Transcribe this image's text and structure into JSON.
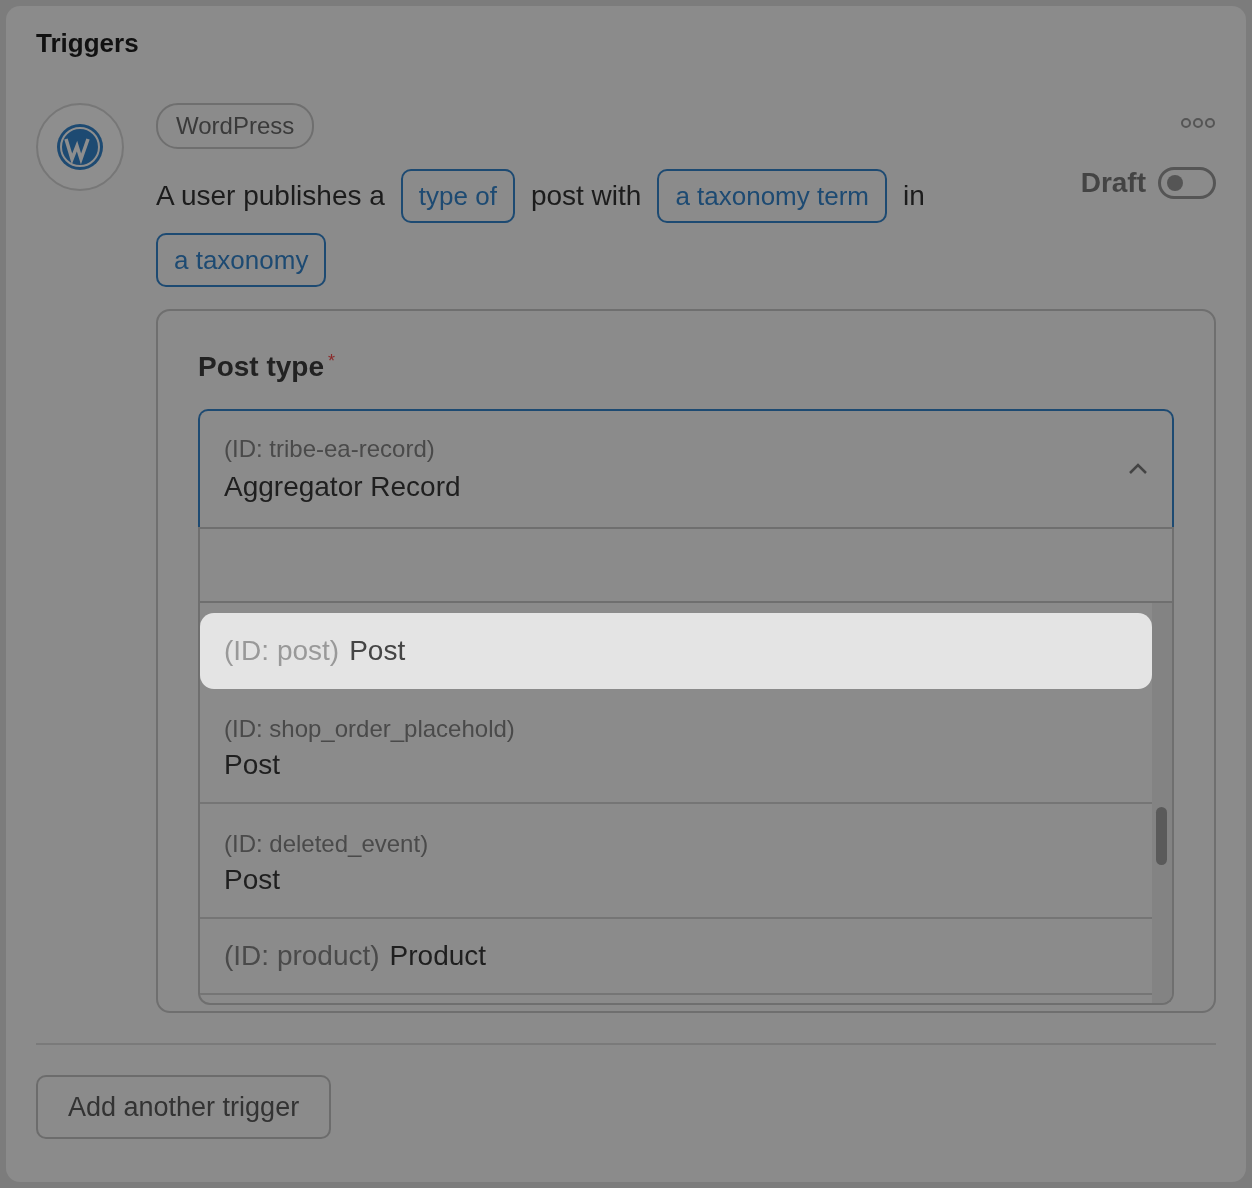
{
  "section_title": "Triggers",
  "trigger": {
    "app_tag": "WordPress",
    "sentence": [
      {
        "kind": "text",
        "text": "A user publishes a"
      },
      {
        "kind": "token",
        "text": "type of"
      },
      {
        "kind": "text",
        "text": "post with"
      },
      {
        "kind": "token",
        "text": "a taxonomy term"
      },
      {
        "kind": "text",
        "text": "in"
      },
      {
        "kind": "token",
        "text": "a taxonomy"
      }
    ],
    "status": {
      "label": "Draft",
      "on": false
    },
    "field": {
      "label": "Post type",
      "required_mark": "*",
      "expanded": true,
      "value_id": "(ID: tribe-ea-record)",
      "value": "Aggregator Record",
      "options": [
        {
          "kind": "inline",
          "id": "(ID: post)",
          "name": "Post",
          "selected": true
        },
        {
          "kind": "stacked",
          "id": "(ID: shop_order_placehold)",
          "name": "Post",
          "selected": false
        },
        {
          "kind": "stacked",
          "id": "(ID: deleted_event)",
          "name": "Post",
          "selected": false
        },
        {
          "kind": "inline",
          "id": "(ID: product)",
          "name": "Product",
          "selected": false
        }
      ]
    }
  },
  "add_button": "Add another trigger"
}
